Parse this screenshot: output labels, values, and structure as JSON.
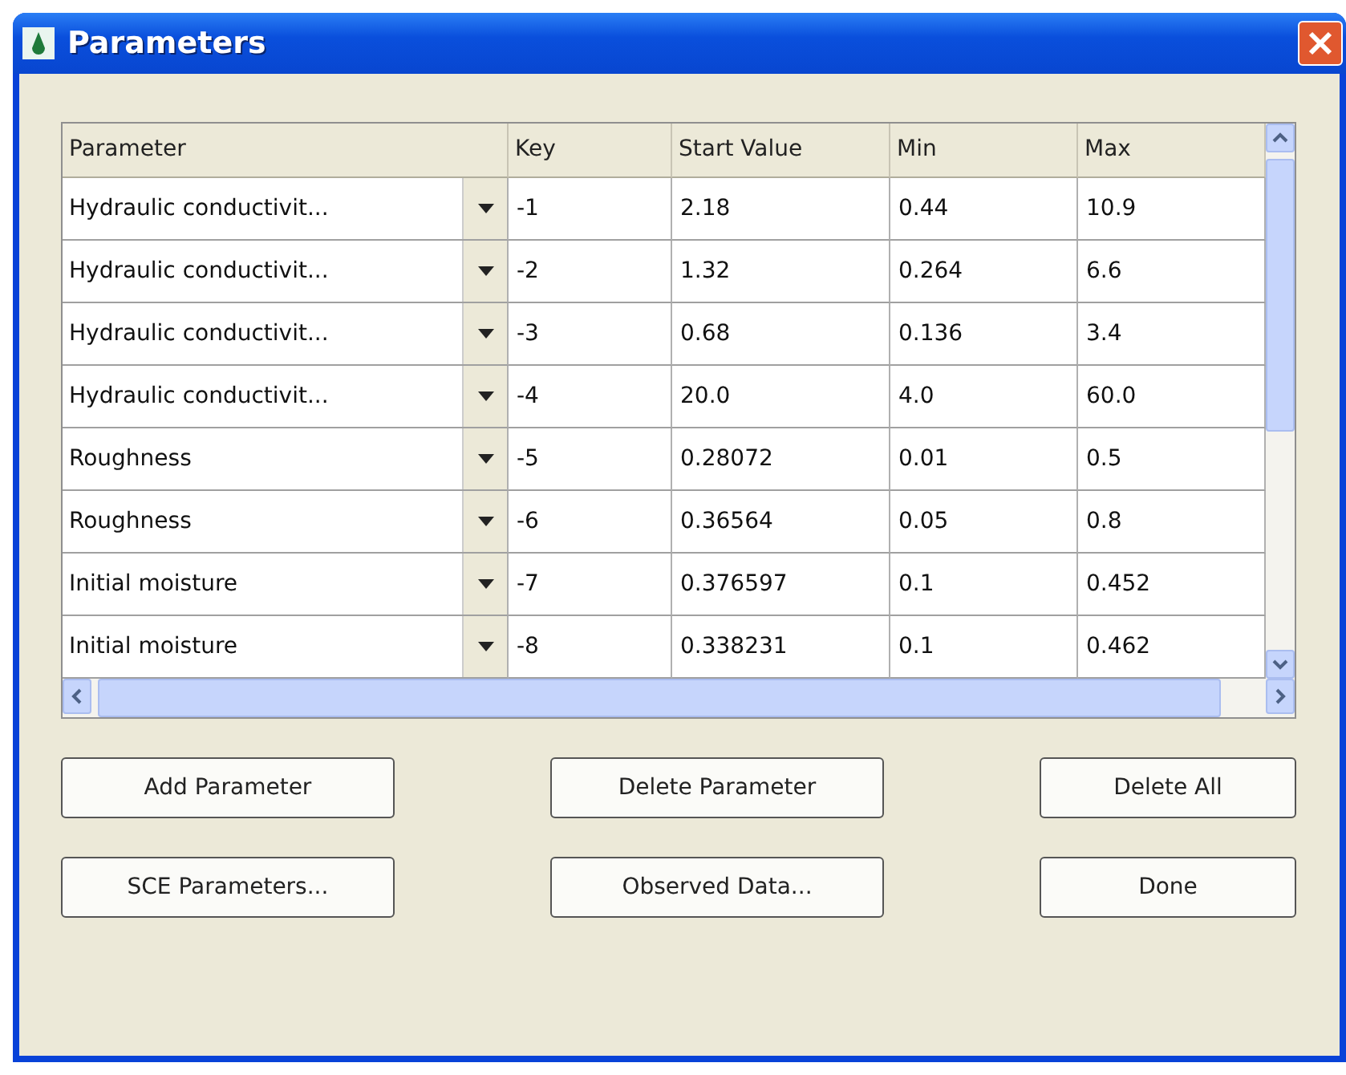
{
  "window": {
    "title": "Parameters"
  },
  "table": {
    "columns": [
      "Parameter",
      "Key",
      "Start Value",
      "Min",
      "Max"
    ],
    "rows": [
      {
        "parameter": "Hydraulic conductivit...",
        "key": "-1",
        "start_value": "2.18",
        "min": "0.44",
        "max": "10.9"
      },
      {
        "parameter": "Hydraulic conductivit...",
        "key": "-2",
        "start_value": "1.32",
        "min": "0.264",
        "max": "6.6"
      },
      {
        "parameter": "Hydraulic conductivit...",
        "key": "-3",
        "start_value": "0.68",
        "min": "0.136",
        "max": "3.4"
      },
      {
        "parameter": "Hydraulic conductivit...",
        "key": "-4",
        "start_value": "20.0",
        "min": "4.0",
        "max": "60.0"
      },
      {
        "parameter": "Roughness",
        "key": "-5",
        "start_value": "0.28072",
        "min": "0.01",
        "max": "0.5"
      },
      {
        "parameter": "Roughness",
        "key": "-6",
        "start_value": "0.36564",
        "min": "0.05",
        "max": "0.8"
      },
      {
        "parameter": "Initial moisture",
        "key": "-7",
        "start_value": "0.376597",
        "min": "0.1",
        "max": "0.452"
      },
      {
        "parameter": "Initial moisture",
        "key": "-8",
        "start_value": "0.338231",
        "min": "0.1",
        "max": "0.462"
      }
    ]
  },
  "buttons": [
    [
      "Add Parameter",
      "Delete Parameter",
      "Delete All"
    ],
    [
      "SCE Parameters...",
      "Observed Data...",
      "Done"
    ]
  ]
}
